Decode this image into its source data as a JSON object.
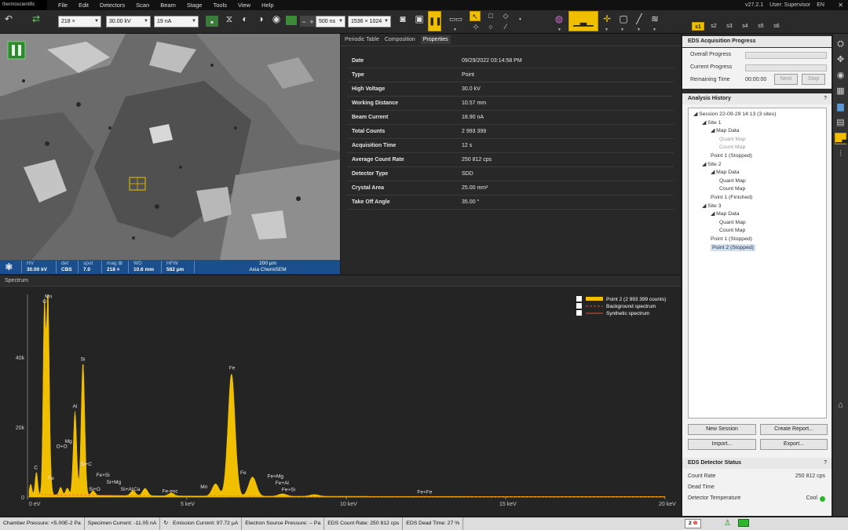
{
  "menubar": {
    "logo": "thermoscientific",
    "items": [
      "File",
      "Edit",
      "Detectors",
      "Scan",
      "Beam",
      "Stage",
      "Tools",
      "View",
      "Help"
    ],
    "version": "v27.2.1",
    "user": "User: Supervisor",
    "language": "EN",
    "close": "✕"
  },
  "toolbar": {
    "magnification": "218 ×",
    "high_voltage": "30.00 kV",
    "beam_current": "19 nA",
    "dwell_time": "500 ns",
    "resolution": "1536 × 1024",
    "sites": [
      "s1",
      "s2",
      "s3",
      "s4",
      "s5",
      "s6"
    ],
    "accent": "#f0c000"
  },
  "image_bar": {
    "hv_label": "HV",
    "hv_value": "30.00 kV",
    "det_label": "det",
    "det_value": "CBS",
    "spot_label": "spot",
    "spot_value": "7.0",
    "mag_label": "mag ⊞",
    "mag_value": "218 ×",
    "wd_label": "WD",
    "wd_value": "10.6 mm",
    "hfw_label": "HFW",
    "hfw_value": "582 µm",
    "scale_label": "200 µm",
    "instrument": "Axia ChemiSEM"
  },
  "properties": {
    "tabs": [
      "Periodic Table",
      "Composition",
      "Properties"
    ],
    "rows": [
      {
        "label": "Date",
        "value": "09/29/2022 03:14:58 PM"
      },
      {
        "label": "Type",
        "value": "Point"
      },
      {
        "label": "High Voltage",
        "value": "30.0 kV"
      },
      {
        "label": "Working Distance",
        "value": "10.57 mm"
      },
      {
        "label": "Beam Current",
        "value": "18.90 nA"
      },
      {
        "label": "Total Counts",
        "value": "2 993 399"
      },
      {
        "label": "Acquisition Time",
        "value": "12 s"
      },
      {
        "label": "Average Count Rate",
        "value": "250 812 cps"
      },
      {
        "label": "Detector Type",
        "value": "SDD"
      },
      {
        "label": "Crystal Area",
        "value": "25.00 mm²"
      },
      {
        "label": "Take Off Angle",
        "value": "35.00 °"
      }
    ]
  },
  "spectrum_title": "Spectrum",
  "chart_data": {
    "type": "line",
    "xlabel": "",
    "ylabel": "",
    "x_ticks": [
      "0 eV",
      "5 keV",
      "10 keV",
      "15 keV",
      "20 keV"
    ],
    "y_ticks": [
      "0",
      "20k",
      "40k"
    ],
    "xlim_kev": [
      0,
      20
    ],
    "ylim": [
      0,
      58000
    ],
    "series": [
      {
        "name": "Point 2 (2 993 399 counts)",
        "color": "#f0c000"
      },
      {
        "name": "Background spectrum",
        "color": "#e0503a"
      },
      {
        "name": "Synthetic spectrum",
        "color": "#e0503a"
      }
    ],
    "peaks": [
      {
        "kev": 0.1,
        "counts": 3000
      },
      {
        "kev": 0.28,
        "counts": 6500
      },
      {
        "kev": 0.53,
        "counts": 54000
      },
      {
        "kev": 0.64,
        "counts": 56000
      },
      {
        "kev": 0.71,
        "counts": 4500
      },
      {
        "kev": 1.04,
        "counts": 2200
      },
      {
        "kev": 1.25,
        "counts": 2000
      },
      {
        "kev": 1.49,
        "counts": 24000
      },
      {
        "kev": 1.74,
        "counts": 38000
      },
      {
        "kev": 2.06,
        "counts": 1300
      },
      {
        "kev": 3.31,
        "counts": 1500
      },
      {
        "kev": 3.69,
        "counts": 2100
      },
      {
        "kev": 4.51,
        "counts": 800
      },
      {
        "kev": 5.9,
        "counts": 3500
      },
      {
        "kev": 6.4,
        "counts": 35000
      },
      {
        "kev": 7.06,
        "counts": 5500
      },
      {
        "kev": 8.0,
        "counts": 700
      },
      {
        "kev": 9.0,
        "counts": 500
      }
    ],
    "labels": [
      {
        "text": "C",
        "kev": 0.28,
        "counts": 8000
      },
      {
        "text": "Mn",
        "kev": 0.62,
        "counts": 57000
      },
      {
        "text": "O",
        "kev": 0.55,
        "counts": 55500
      },
      {
        "text": "Fe",
        "kev": 0.72,
        "counts": 5000
      },
      {
        "text": "O+O",
        "kev": 0.98,
        "counts": 14000
      },
      {
        "text": "Mg",
        "kev": 1.25,
        "counts": 15500
      },
      {
        "text": "Al",
        "kev": 1.49,
        "counts": 25500
      },
      {
        "text": "Si",
        "kev": 1.74,
        "counts": 39000
      },
      {
        "text": "Si+C",
        "kev": 1.74,
        "counts": 9000
      },
      {
        "text": "Si+O",
        "kev": 2.0,
        "counts": 1800
      },
      {
        "text": "Fe+Si",
        "kev": 2.23,
        "counts": 5800
      },
      {
        "text": "Si+Mg",
        "kev": 2.55,
        "counts": 3800
      },
      {
        "text": "Si+Al",
        "kev": 3.0,
        "counts": 1800
      },
      {
        "text": "Ca",
        "kev": 3.4,
        "counts": 1800
      },
      {
        "text": "Fe-esc",
        "kev": 4.3,
        "counts": 1200
      },
      {
        "text": "Mn",
        "kev": 5.5,
        "counts": 2500
      },
      {
        "text": "Fe",
        "kev": 6.4,
        "counts": 36500
      },
      {
        "text": "Fe",
        "kev": 6.75,
        "counts": 6500
      },
      {
        "text": "Fe+Mg",
        "kev": 7.6,
        "counts": 5500
      },
      {
        "text": "Fe+Al",
        "kev": 7.85,
        "counts": 3600
      },
      {
        "text": "Fe+Si",
        "kev": 8.05,
        "counts": 1700
      },
      {
        "text": "Fe+Fe",
        "kev": 12.3,
        "counts": 1000
      }
    ]
  },
  "acquisition": {
    "title": "EDS Acquisition Progress",
    "overall_label": "Overall Progress",
    "current_label": "Current Progress",
    "remaining_label": "Remaining Time",
    "remaining_value": "00:00:00",
    "next_label": "Next",
    "stop_label": "Stop",
    "overall_progress": 0,
    "current_progress": 0
  },
  "history": {
    "title": "Analysis History",
    "help": "?",
    "tree": [
      {
        "text": "Session 22-09-29 14:13 (3 sites)",
        "level": 0,
        "dim": false
      },
      {
        "text": "Site 1",
        "level": 1,
        "dim": false
      },
      {
        "text": "Map Data",
        "level": 2,
        "dim": false
      },
      {
        "text": "Quant Map",
        "level": 3,
        "dim": true
      },
      {
        "text": "Count Map",
        "level": 3,
        "dim": true
      },
      {
        "text": "Point 1 (Stopped)",
        "level": 2,
        "dim": false
      },
      {
        "text": "Site 2",
        "level": 1,
        "dim": false
      },
      {
        "text": "Map Data",
        "level": 2,
        "dim": false
      },
      {
        "text": "Quant Map",
        "level": 3,
        "dim": false
      },
      {
        "text": "Count Map",
        "level": 3,
        "dim": false
      },
      {
        "text": "Point 1 (Finished)",
        "level": 2,
        "dim": false
      },
      {
        "text": "Site 3",
        "level": 1,
        "dim": false
      },
      {
        "text": "Map Data",
        "level": 2,
        "dim": false
      },
      {
        "text": "Quant Map",
        "level": 3,
        "dim": false
      },
      {
        "text": "Count Map",
        "level": 3,
        "dim": false
      },
      {
        "text": "Point 1 (Stopped)",
        "level": 2,
        "dim": false
      },
      {
        "text": "Point 2 (Stopped)",
        "level": 2,
        "dim": false,
        "selected": true
      }
    ],
    "buttons": [
      "New Session",
      "Create Report...",
      "Import...",
      "Export..."
    ]
  },
  "detector": {
    "title": "EDS Detector Status",
    "help": "?",
    "count_rate_label": "Count Rate",
    "count_rate_value": "250 812 cps",
    "dead_time_label": "Dead Time",
    "temperature_label": "Detector Temperature",
    "temperature_value": "Cool"
  },
  "status": {
    "chamber": "Chamber Pressure: <5.00E-2 Pa",
    "specimen": "Specimen Current: -11.05 nA",
    "emission": "Emission Current: 97.72 µA",
    "source": "Electron Source Pressure: -- Pa",
    "eds_rate": "EDS Count Rate: 250 812 cps",
    "dead_time": "EDS Dead Time: 27 %",
    "errors": "2"
  }
}
